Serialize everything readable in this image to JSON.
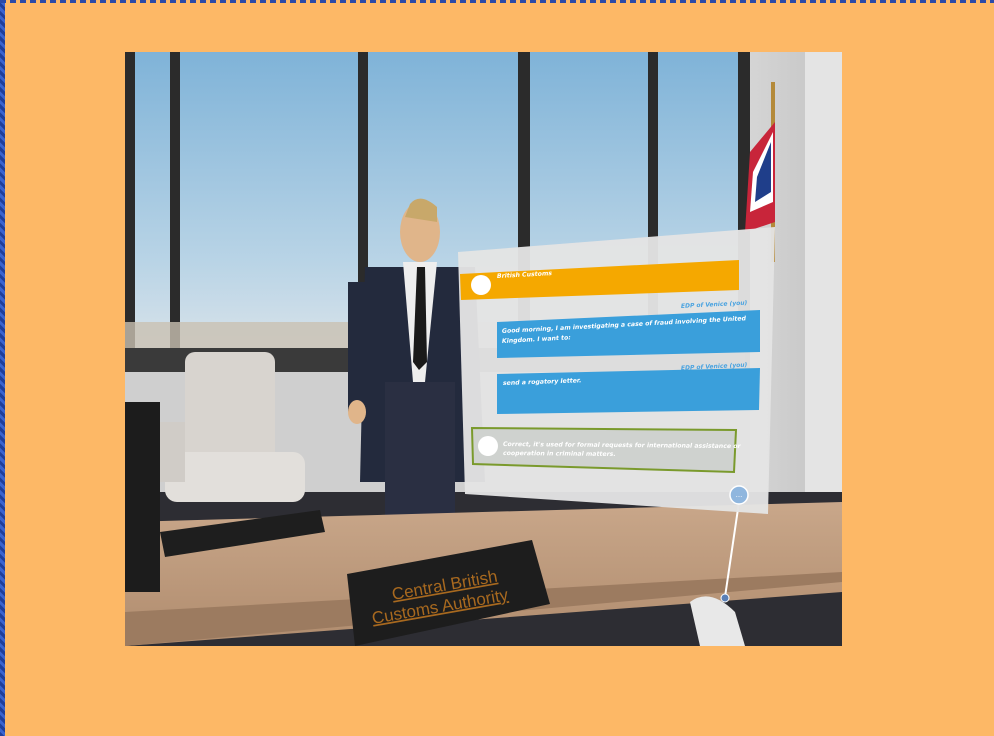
{
  "nameplate": {
    "line1": "Central British",
    "line2": "Customs Authority"
  },
  "chat": {
    "header_label": "British Customs",
    "messages": [
      {
        "sender": "EDP of Venice (you)",
        "line1": "Good morning, I am investigating a case of fraud involving the United",
        "line2": "Kingdom. I want to:"
      },
      {
        "sender": "EDP of Venice (you)",
        "line1": "send a rogatory letter.",
        "line2": ""
      }
    ],
    "reply": {
      "line1": "Correct, it's used for formal requests for international assistance or",
      "line2": "cooperation in criminal matters."
    },
    "menu_button_label": "..."
  },
  "colors": {
    "background": "#fdb866",
    "header_bar": "#f5a800",
    "user_bubble": "#3a9fdb",
    "reply_border": "#7a9a2c",
    "panel": "#e4e4e4"
  }
}
